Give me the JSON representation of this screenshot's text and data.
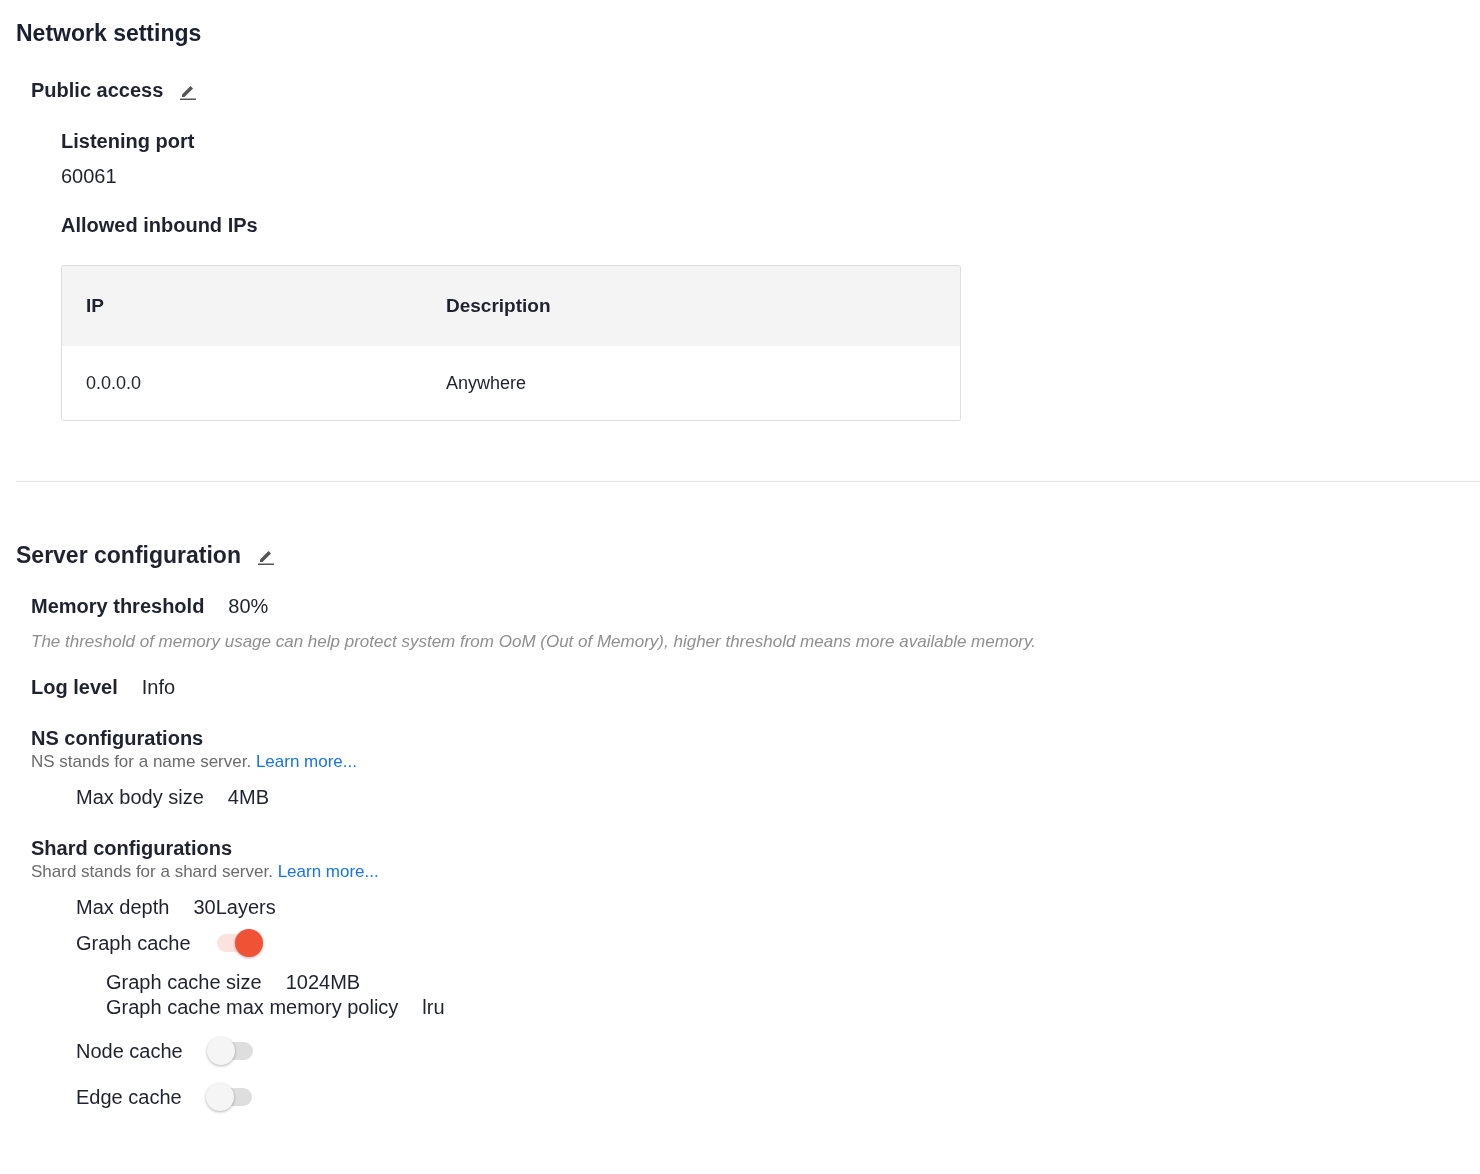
{
  "network_settings": {
    "title": "Network settings",
    "public_access": {
      "title": "Public access",
      "listening_port": {
        "label": "Listening port",
        "value": "60061"
      },
      "allowed_ips": {
        "label": "Allowed inbound IPs",
        "columns": [
          "IP",
          "Description"
        ],
        "rows": [
          [
            "0.0.0.0",
            "Anywhere"
          ]
        ]
      }
    }
  },
  "server_configuration": {
    "title": "Server configuration",
    "memory_threshold": {
      "label": "Memory threshold",
      "value": "80%",
      "description": "The threshold of memory usage can help protect system from OoM (Out of Memory), higher threshold means more available memory."
    },
    "log_level": {
      "label": "Log level",
      "value": "Info"
    },
    "groups": [
      {
        "title": "NS configurations",
        "note": "NS stands for a name server.",
        "link": "Learn more...",
        "items": [
          {
            "kind": "value",
            "label": "Max body size",
            "value": "4MB"
          }
        ]
      },
      {
        "title": "Shard configurations",
        "note": "Shard stands for a shard server.",
        "link": "Learn more...",
        "items": [
          {
            "kind": "value",
            "label": "Max depth",
            "value": "30Layers"
          },
          {
            "kind": "switch",
            "label": "Graph cache",
            "on": true,
            "children": [
              {
                "label": "Graph cache size",
                "value": "1024MB"
              },
              {
                "label": "Graph cache max memory policy",
                "value": "lru"
              }
            ]
          },
          {
            "kind": "switch",
            "label": "Node cache",
            "on": false
          },
          {
            "kind": "switch",
            "label": "Edge cache",
            "on": false
          }
        ]
      }
    ]
  }
}
